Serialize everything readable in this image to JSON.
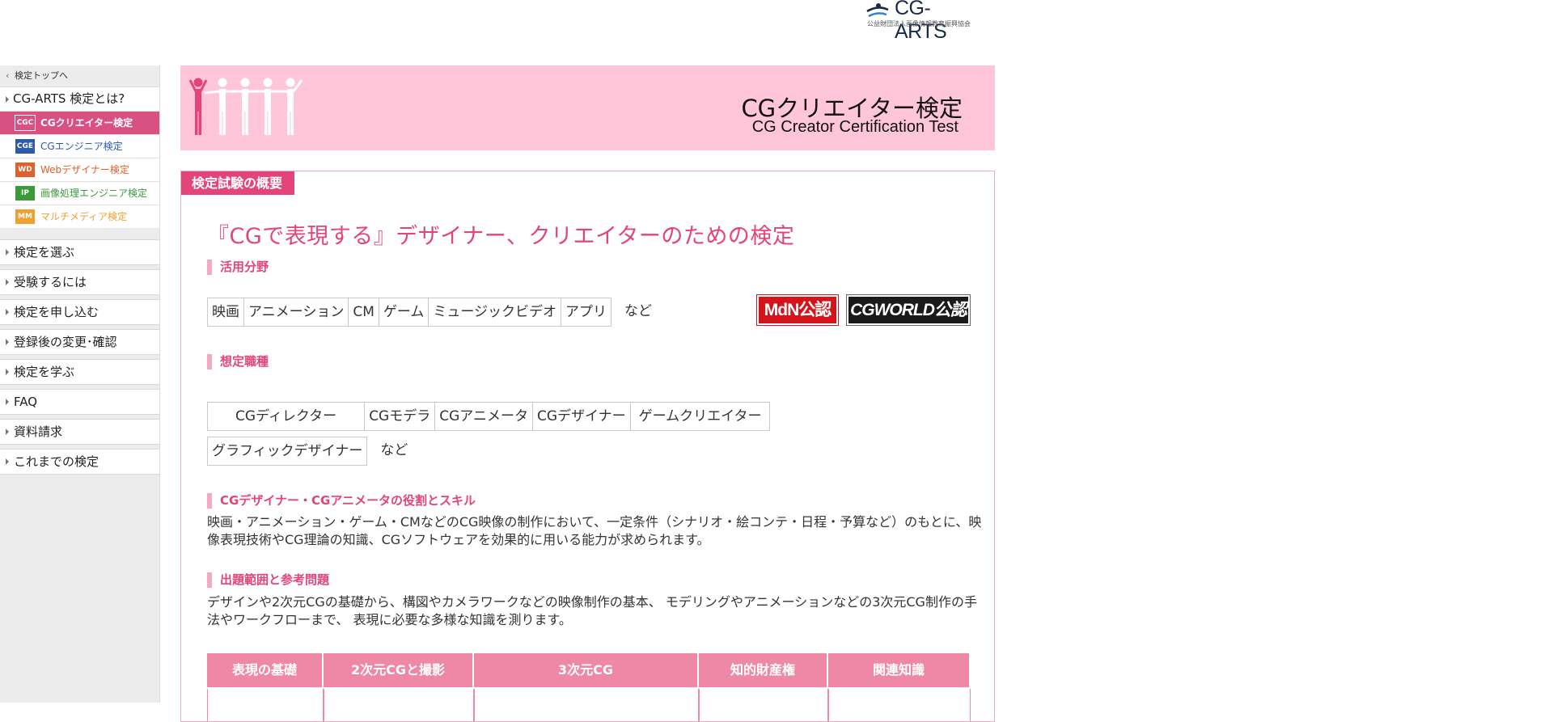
{
  "logo": {
    "name": "CG-ARTS",
    "subtitle": "公益財団法人画像情報教育振興協会"
  },
  "sidebar": {
    "back_label": "検定トップへ",
    "about_label": "CG-ARTS 検定とは?",
    "tests": [
      {
        "badge": "CGC",
        "label": "CGクリエイター検定",
        "color": "#d95182",
        "active": true
      },
      {
        "badge": "CGE",
        "label": "CGエンジニア検定",
        "color": "#2c5aa8",
        "active": false
      },
      {
        "badge": "WD",
        "label": "Webデザイナー検定",
        "color": "#e0602a",
        "active": false
      },
      {
        "badge": "IP",
        "label": "画像処理エンジニア検定",
        "color": "#3a9a3a",
        "active": false
      },
      {
        "badge": "MM",
        "label": "マルチメディア検定",
        "color": "#f0a030",
        "active": false
      }
    ],
    "nav": [
      {
        "label": "検定を選ぶ"
      },
      {
        "label": "受験するには"
      },
      {
        "label": "検定を申し込む"
      },
      {
        "label": "登録後の変更･確認"
      },
      {
        "label": "検定を学ぶ"
      },
      {
        "label": "FAQ"
      },
      {
        "label": "資料請求"
      },
      {
        "label": "これまでの検定"
      }
    ]
  },
  "banner": {
    "title_jp": "CGクリエイター検定",
    "title_en": "CG Creator Certification Test"
  },
  "panel": {
    "tab_label": "検定試験の概要",
    "headline": "『CGで表現する』デザイナー、クリエイターのための検定",
    "fields_heading": "活用分野",
    "fields": [
      "映画",
      "アニメーション",
      "CM",
      "ゲーム",
      "ミュージックビデオ",
      "アプリ"
    ],
    "etc": "など",
    "seals": {
      "mdn": "MdN公認",
      "cgworld": "CGWORLD公認"
    },
    "jobs_heading": "想定職種",
    "jobs_row1": [
      "CGディレクター",
      "CGモデラ",
      "CGアニメータ",
      "CGデザイナー",
      "ゲームクリエイター"
    ],
    "jobs_row2": [
      "グラフィックデザイナー"
    ],
    "role_heading": "CGデザイナー・CGアニメータの役割とスキル",
    "role_text": "映画・アニメーション・ゲーム・CMなどのCG映像の制作において、一定条件（シナリオ・絵コンテ・日程・予算など）のもとに、映像表現技術やCG理論の知識、CGソフトウェアを効果的に用いる能力が求められます。",
    "scope_heading": "出題範囲と参考問題",
    "scope_text": "デザインや2次元CGの基礎から、構図やカメラワークなどの映像制作の基本、 モデリングやアニメーションなどの3次元CG制作の手法やワークフローまで、 表現に必要な多様な知識を測ります。",
    "table_headers": [
      "表現の基礎",
      "2次元CGと撮影",
      "3次元CG",
      "知的財産権",
      "関連知識"
    ]
  }
}
